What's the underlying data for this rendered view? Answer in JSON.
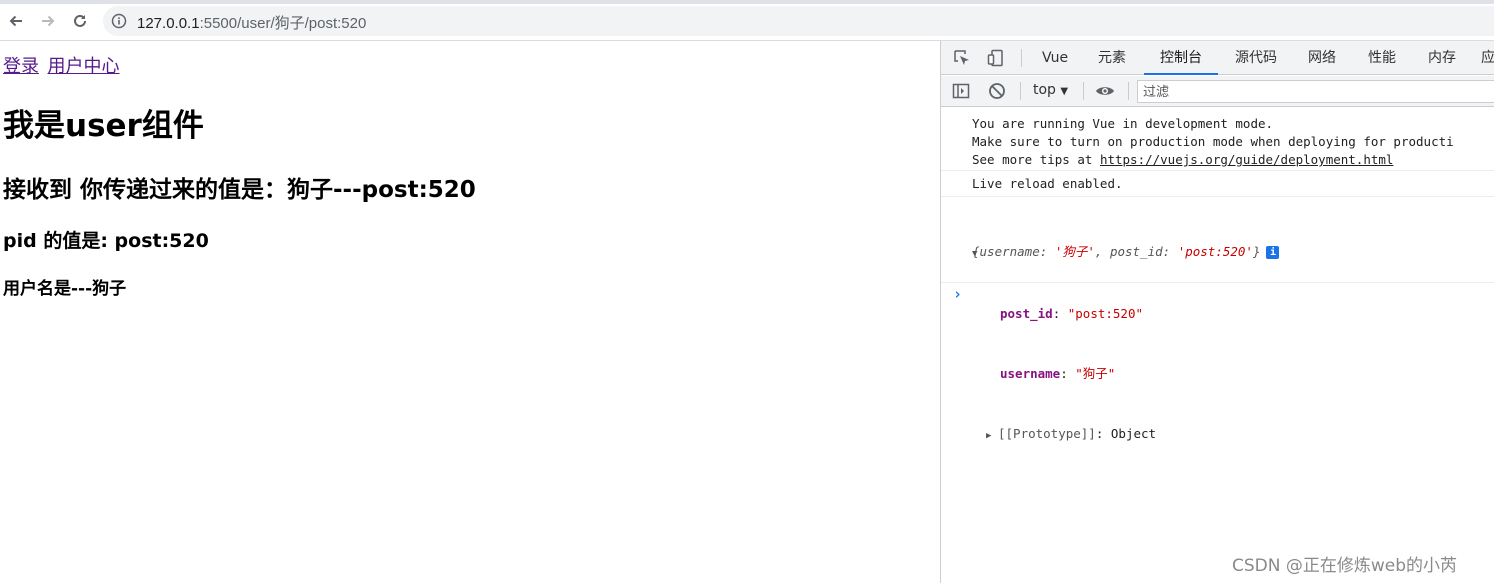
{
  "browser": {
    "url_host": "127.0.0.1",
    "url_rest": ":5500/user/狗子/post:520",
    "icons": [
      "back-icon",
      "forward-icon",
      "reload-icon",
      "info-icon"
    ]
  },
  "page": {
    "links": [
      "登录",
      "用户中心"
    ],
    "heading": "我是user组件",
    "received": "接收到 你传递过来的值是：狗子---post:520",
    "pid_line": "pid 的值是: post:520",
    "username_line": "用户名是---狗子"
  },
  "devtools": {
    "tabs": [
      "Vue",
      "元素",
      "控制台",
      "源代码",
      "网络",
      "性能",
      "内存",
      "应"
    ],
    "active_tab": "控制台",
    "context": "top",
    "filter_placeholder": "过滤",
    "console": {
      "vue_line1": "You are running Vue in development mode.",
      "vue_line2": "Make sure to turn on production mode when deploying for producti",
      "vue_line3_prefix": "See more tips at ",
      "vue_link": "https://vuejs.org/guide/deployment.html",
      "live_reload": "Live reload enabled.",
      "obj_open": "{",
      "obj_k1": "username",
      "obj_colon1": ": ",
      "obj_v1": "'狗子'",
      "obj_sep": ", ",
      "obj_k2": "post_id",
      "obj_colon2": ": ",
      "obj_v2": "'post:520'",
      "obj_close": "}",
      "info_badge": "i",
      "prop1_key": "post_id",
      "prop1_val": "\"post:520\"",
      "prop2_key": "username",
      "prop2_val": "\"狗子\"",
      "proto_key": "[[Prototype]]",
      "proto_val": "Object",
      "colon": ": "
    }
  },
  "watermark": "CSDN @正在修炼web的小芮",
  "colors": {
    "accent": "#1a73e8",
    "link": "#551a8b",
    "string": "#c80000",
    "prop_key": "#881280"
  }
}
